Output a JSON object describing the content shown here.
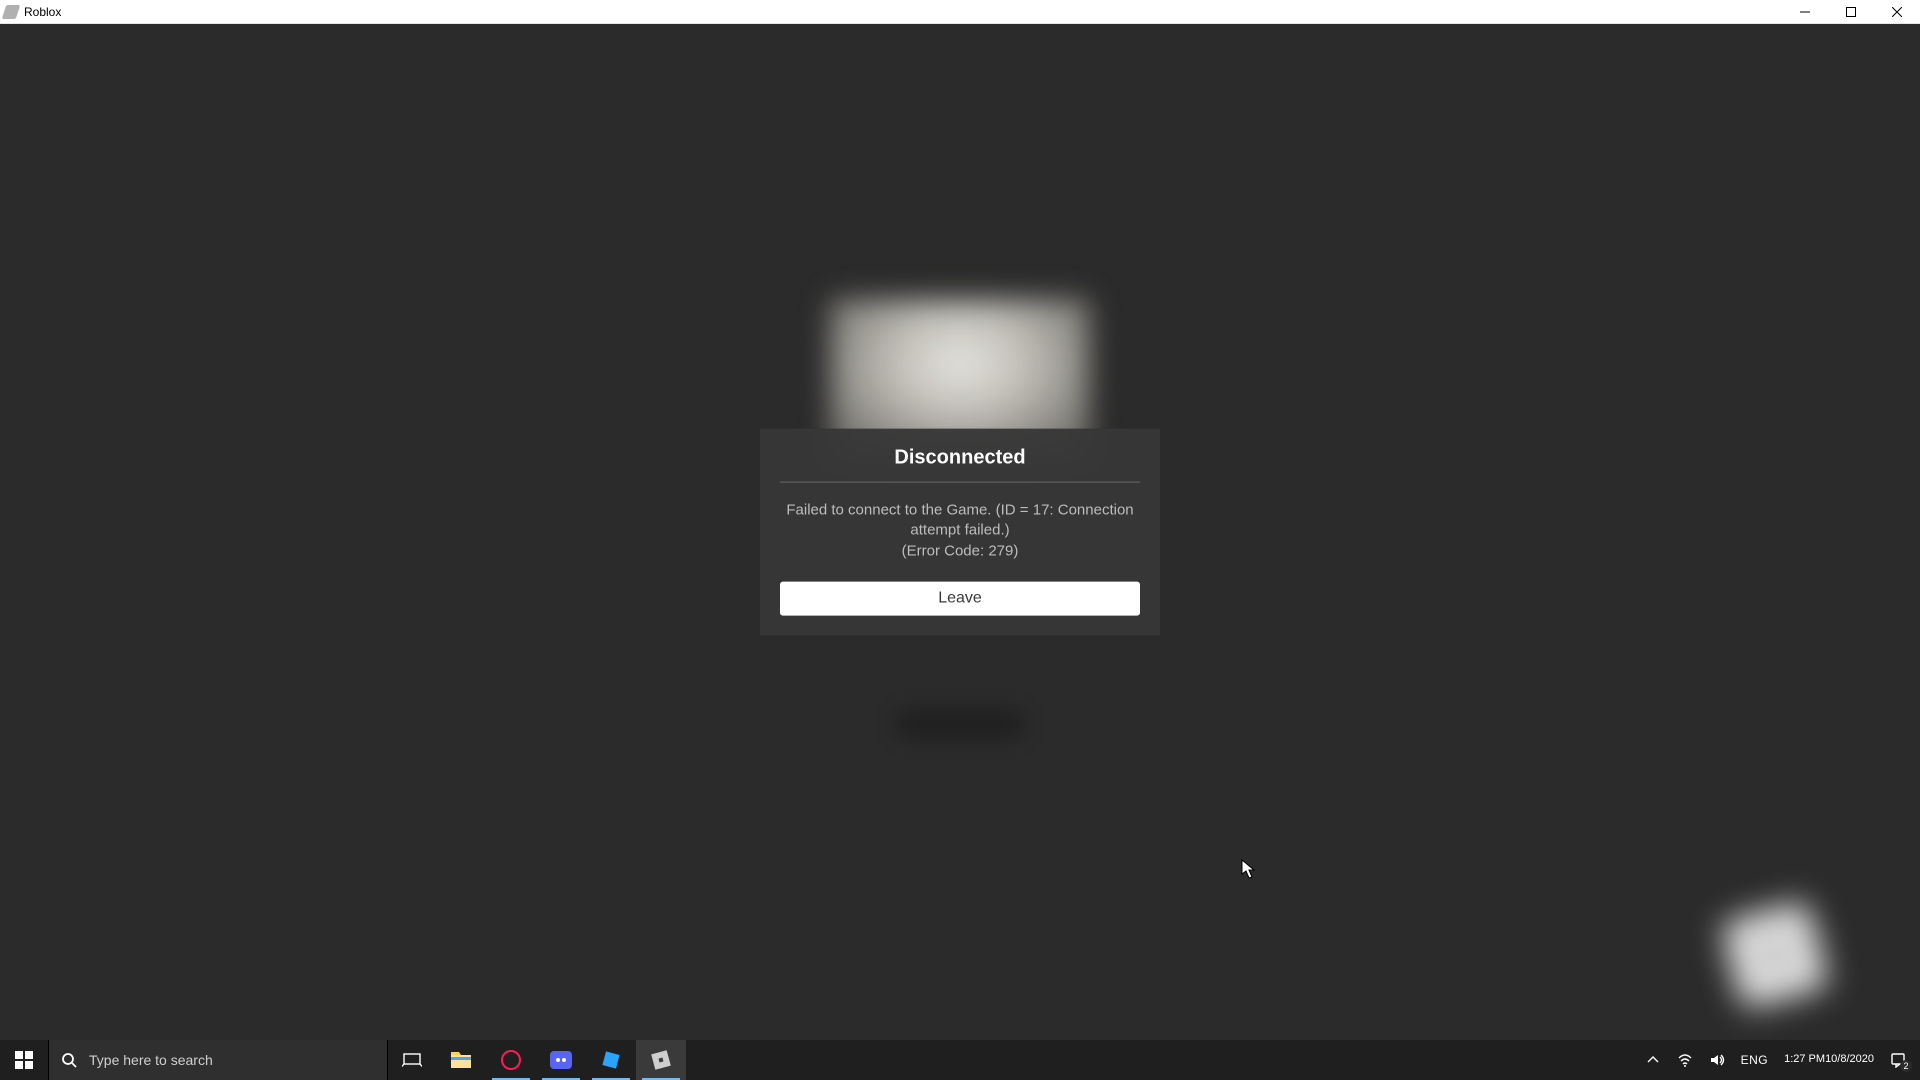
{
  "window": {
    "app_title": "Roblox"
  },
  "dialog": {
    "title": "Disconnected",
    "message_line1": "Failed to connect to the Game. (ID = 17: Connection attempt failed.)",
    "message_line2": "(Error Code: 279)",
    "button_label": "Leave"
  },
  "taskbar": {
    "search_placeholder": "Type here to search",
    "lang": "ENG",
    "time": "1:27 PM",
    "date": "10/8/2020",
    "notifications_count": "2"
  }
}
